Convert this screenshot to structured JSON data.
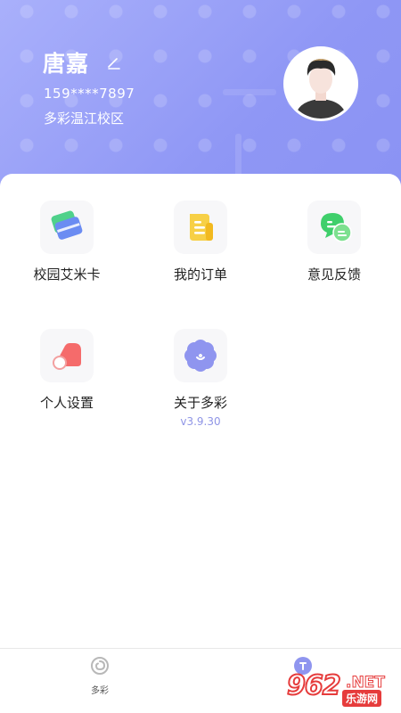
{
  "profile": {
    "name": "唐嘉",
    "phone": "159****7897",
    "campus": "多彩温江校区"
  },
  "menu": [
    {
      "label": "校园艾米卡",
      "icon": "campus-card-icon"
    },
    {
      "label": "我的订单",
      "icon": "order-document-icon"
    },
    {
      "label": "意见反馈",
      "icon": "feedback-chat-icon"
    },
    {
      "label": "个人设置",
      "icon": "toggle-settings-icon"
    },
    {
      "label": "关于多彩",
      "icon": "about-flower-icon",
      "sub": "v3.9.30"
    }
  ],
  "tabbar": {
    "tabs": [
      {
        "label": "多彩",
        "icon": "swirl-icon",
        "active": false
      },
      {
        "label": "",
        "icon": "profile-icon",
        "active": true
      }
    ]
  },
  "watermark": {
    "number": "962",
    "net": ".NET",
    "site": "乐游网"
  },
  "colors": {
    "header_start": "#a9b0fb",
    "header_end": "#8a92f3",
    "version_text": "#8f95e6",
    "watermark_red": "#e63c3c"
  }
}
